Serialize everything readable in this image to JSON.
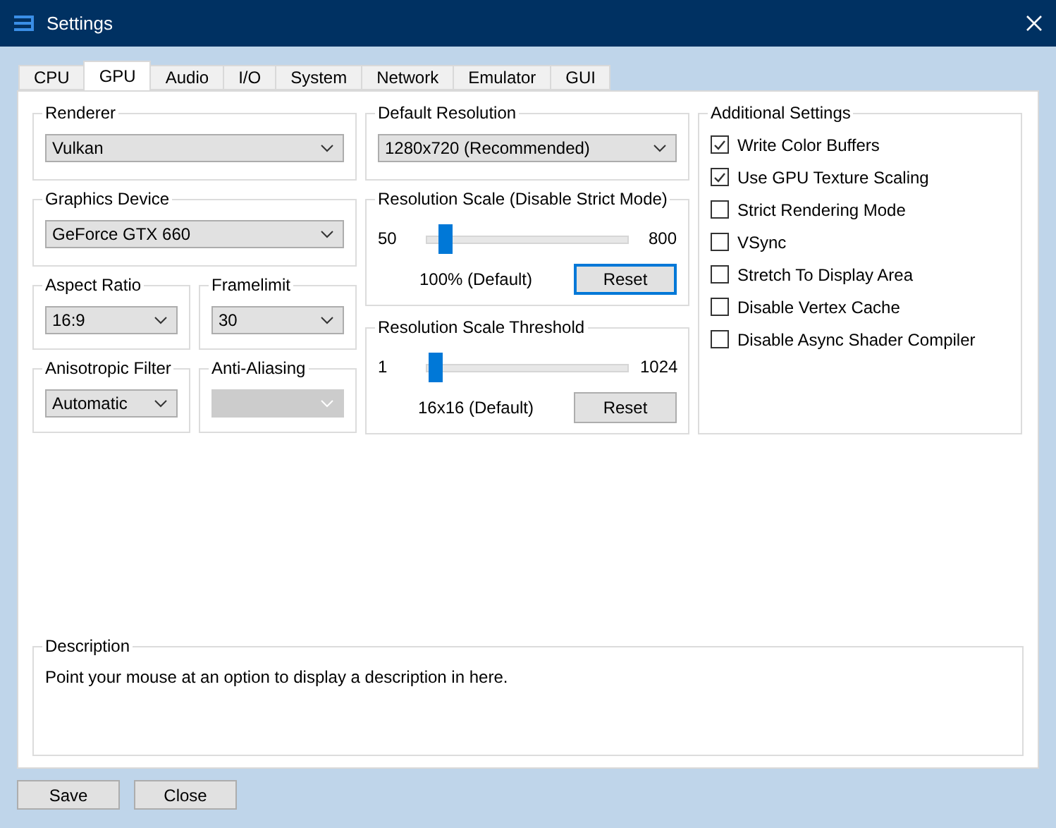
{
  "window": {
    "title": "Settings"
  },
  "tabs": [
    {
      "label": "CPU",
      "selected": false
    },
    {
      "label": "GPU",
      "selected": true
    },
    {
      "label": "Audio",
      "selected": false
    },
    {
      "label": "I/O",
      "selected": false
    },
    {
      "label": "System",
      "selected": false
    },
    {
      "label": "Network",
      "selected": false
    },
    {
      "label": "Emulator",
      "selected": false
    },
    {
      "label": "GUI",
      "selected": false
    }
  ],
  "left_groups": [
    {
      "row": [
        {
          "title": "Renderer",
          "value": "Vulkan",
          "disabled": false
        }
      ]
    },
    {
      "row": [
        {
          "title": "Graphics Device",
          "value": "GeForce GTX 660",
          "disabled": false
        }
      ]
    },
    {
      "row": [
        {
          "title": "Aspect Ratio",
          "value": "16:9",
          "disabled": false
        },
        {
          "title": "Framelimit",
          "value": "30",
          "disabled": false
        }
      ]
    },
    {
      "row": [
        {
          "title": "Anisotropic Filter",
          "value": "Automatic",
          "disabled": false
        },
        {
          "title": "Anti-Aliasing",
          "disabled": true
        }
      ]
    }
  ],
  "default_resolution": {
    "title": "Default Resolution",
    "value": "1280x720 (Recommended)"
  },
  "sliders": [
    {
      "title": "Resolution Scale (Disable Strict Mode)",
      "min": "50",
      "max": "800",
      "level": 0.067,
      "reading": "100% (Default)",
      "button": "Reset",
      "focused": true
    },
    {
      "title": "Resolution Scale Threshold",
      "min": "1",
      "max": "1024",
      "level": 0.015,
      "reading": "16x16 (Default)",
      "button": "Reset",
      "focused": false
    }
  ],
  "additional_settings": {
    "title": "Additional Settings",
    "items": [
      {
        "label": "Write Color Buffers",
        "checked": true
      },
      {
        "label": "Use GPU Texture Scaling",
        "checked": true
      },
      {
        "label": "Strict Rendering Mode",
        "checked": false
      },
      {
        "label": "VSync",
        "checked": false
      },
      {
        "label": "Stretch To Display Area",
        "checked": false
      },
      {
        "label": "Disable Vertex Cache",
        "checked": false
      },
      {
        "label": "Disable Async Shader Compiler",
        "checked": false
      }
    ]
  },
  "description": {
    "title": "Description",
    "text": "Point your mouse at an option to display a description in here."
  },
  "buttons": [
    "Save",
    "Close"
  ]
}
